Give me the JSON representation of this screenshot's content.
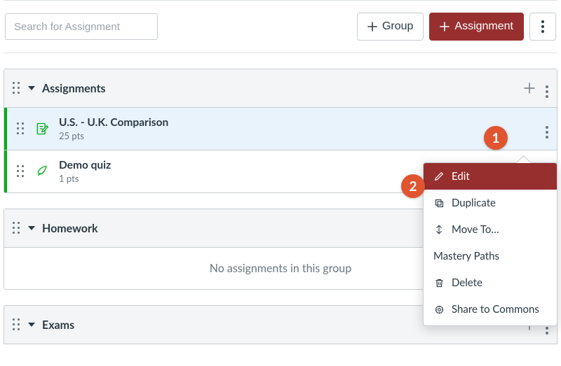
{
  "toolbar": {
    "search_placeholder": "Search for Assignment",
    "group_button": "Group",
    "assignment_button": "Assignment"
  },
  "callouts": {
    "one": "1",
    "two": "2"
  },
  "groups": {
    "assignments": {
      "title": "Assignments",
      "items": [
        {
          "title": "U.S. - U.K. Comparison",
          "sub": "25 pts"
        },
        {
          "title": "Demo quiz",
          "sub": "1 pts"
        }
      ]
    },
    "homework": {
      "title": "Homework",
      "empty_text": "No assignments in this group"
    },
    "exams": {
      "title": "Exams"
    }
  },
  "menu": {
    "edit": "Edit",
    "duplicate": "Duplicate",
    "move_to": "Move To…",
    "mastery_paths": "Mastery Paths",
    "delete": "Delete",
    "share_commons": "Share to Commons"
  }
}
